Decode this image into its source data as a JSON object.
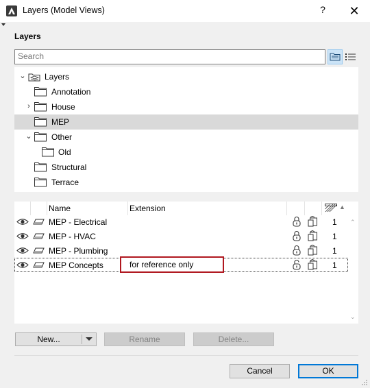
{
  "window": {
    "title": "Layers (Model Views)",
    "help_glyph": "?",
    "close_glyph": "✕"
  },
  "section_label": "Layers",
  "search": {
    "placeholder": "Search",
    "value": ""
  },
  "tree": {
    "items": [
      {
        "label": "Layers",
        "expanded": true,
        "icon": "layers-stack-icon"
      },
      {
        "label": "Annotation",
        "icon": "folder-icon"
      },
      {
        "label": "House",
        "expandable": true,
        "icon": "folder-icon"
      },
      {
        "label": "MEP",
        "selected": true,
        "icon": "folder-icon"
      },
      {
        "label": "Other",
        "expanded": true,
        "icon": "folder-icon"
      },
      {
        "label": "Old",
        "icon": "folder-icon"
      },
      {
        "label": "Structural",
        "icon": "folder-icon"
      },
      {
        "label": "Terrace",
        "icon": "folder-icon"
      }
    ]
  },
  "list": {
    "columns": {
      "name": "Name",
      "extension": "Extension"
    },
    "rows": [
      {
        "name": "MEP - Electrical",
        "extension": "",
        "locked": true,
        "count": "1"
      },
      {
        "name": "MEP - HVAC",
        "extension": "",
        "locked": true,
        "count": "1"
      },
      {
        "name": "MEP - Plumbing",
        "extension": "",
        "locked": true,
        "count": "1"
      },
      {
        "name": "MEP Concepts",
        "extension": "for reference only",
        "locked": false,
        "count": "1",
        "editing": true
      }
    ]
  },
  "buttons": {
    "new": "New...",
    "rename": "Rename",
    "delete": "Delete...",
    "cancel": "Cancel",
    "ok": "OK"
  },
  "colors": {
    "selection": "#d9d9d9",
    "edit_border": "#b0171f",
    "focus_accent": "#0078d7"
  }
}
